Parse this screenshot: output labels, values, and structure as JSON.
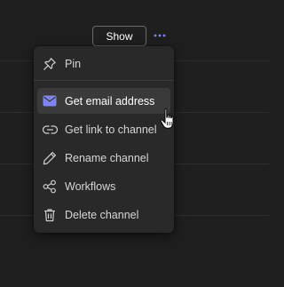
{
  "channel_row": {
    "show_label": "Show",
    "more_icon": "more-horizontal-icon"
  },
  "menu": {
    "items": [
      {
        "label": "Pin",
        "icon": "pin-icon"
      },
      {
        "label": "Get email address",
        "icon": "mail-icon"
      },
      {
        "label": "Get link to channel",
        "icon": "link-icon"
      },
      {
        "label": "Rename channel",
        "icon": "pencil-icon"
      },
      {
        "label": "Workflows",
        "icon": "workflows-icon"
      },
      {
        "label": "Delete channel",
        "icon": "trash-icon"
      }
    ]
  },
  "colors": {
    "background": "#1f1f1f",
    "menu": "#292929",
    "hover": "#3a3a3a",
    "accent": "#7f85f5"
  }
}
